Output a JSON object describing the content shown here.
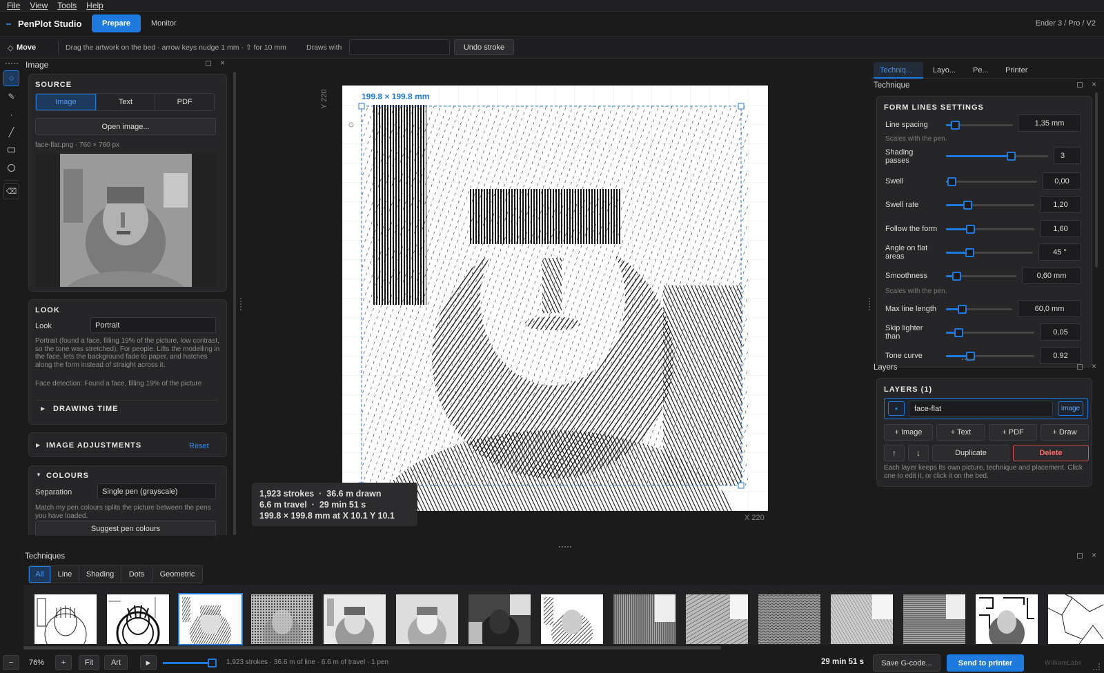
{
  "menu": [
    "File",
    "View",
    "Tools",
    "Help"
  ],
  "app": {
    "name": "PenPlot Studio",
    "tab_prepare": "Prepare",
    "tab_monitor": "Monitor",
    "printer_model": "Ender 3 / Pro / V2"
  },
  "toolbar": {
    "tool": "Move",
    "hint": "Drag the artwork on the bed · arrow keys nudge 1 mm · ⇧ for 10 mm",
    "draws_with": "Draws with",
    "draws_with_value": "",
    "undo": "Undo stroke"
  },
  "left": {
    "title": "Image",
    "source": {
      "heading": "SOURCE",
      "tabs": [
        "Image",
        "Text",
        "PDF"
      ],
      "open": "Open image...",
      "file": "face-flat.png · 760 × 760 px"
    },
    "look": {
      "heading": "LOOK",
      "label": "Look",
      "value": "Portrait",
      "desc": "Portrait (found a face, filling 19% of the picture, low contrast, so the tone was stretched). For people. Lifts the modelling in the face, lets the background fade to paper, and hatches along the form instead of straight across it.",
      "face": "Face detection: Found a face, filling 19% of the picture",
      "drawing_time": "DRAWING TIME"
    },
    "adjust": {
      "heading": "IMAGE ADJUSTMENTS",
      "reset": "Reset"
    },
    "colours": {
      "heading": "COLOURS",
      "label": "Separation",
      "value": "Single pen (grayscale)",
      "desc": "Match my pen colours splits the picture between the pens you have loaded.",
      "suggest": "Suggest pen colours"
    }
  },
  "canvas": {
    "ylabel": "Y 220",
    "xlabel": "X 220",
    "dims": "199.8 × 199.8 mm",
    "info": {
      "l1a": "1,923 strokes",
      "l1b": "36.6 m drawn",
      "l2a": "6.6 m travel",
      "l2b": "29 min 51 s",
      "l3": "199.8 × 199.8 mm at X 10.1  Y 10.1"
    }
  },
  "right": {
    "tabs": [
      "Techniq...",
      "Layo...",
      "Pe...",
      "Printer"
    ],
    "technique_title": "Technique",
    "settings_heading": "FORM LINES SETTINGS",
    "settings": [
      {
        "label": "Line spacing",
        "value": "1,35 mm",
        "hint": "Scales with the pen.",
        "pos": 0.08
      },
      {
        "label": "Shading passes",
        "value": "3",
        "pos": 0.65
      },
      {
        "label": "Swell",
        "value": "0,00",
        "pos": 0.02
      },
      {
        "label": "Swell rate",
        "value": "1,20",
        "pos": 0.22
      },
      {
        "label": "Follow the form",
        "value": "1,60",
        "pos": 0.25
      },
      {
        "label": "Angle on flat areas",
        "value": "45 °",
        "pos": 0.25
      },
      {
        "label": "Smoothness",
        "value": "0,60 mm",
        "hint": "Scales with the pen.",
        "pos": 0.1
      },
      {
        "label": "Max line length",
        "value": "60,0 mm",
        "pos": 0.2
      },
      {
        "label": "Skip lighter than",
        "value": "0,05",
        "pos": 0.1
      },
      {
        "label": "Tone curve",
        "value": "0.92",
        "pos": 0.25
      }
    ],
    "layers_title": "Layers",
    "layers_heading": "LAYERS  (1)",
    "layer": {
      "name": "face-flat",
      "type": "image"
    },
    "add": [
      "+ Image",
      "+ Text",
      "+ PDF",
      "+ Draw"
    ],
    "up": "↑",
    "down": "↓",
    "duplicate": "Duplicate",
    "delete": "Delete",
    "note": "Each layer keeps its own picture, technique and placement. Click one to edit it, or click it on the bed."
  },
  "techniques": {
    "title": "Techniques",
    "filters": [
      "All",
      "Line",
      "Shading",
      "Dots",
      "Geometric"
    ]
  },
  "status": {
    "minus": "−",
    "zoom": "76%",
    "plus": "+",
    "fit": "Fit",
    "art": "Art",
    "play": "▶",
    "summary": "1,923 strokes · 36.6 m of line · 6.6 m of travel · 1 pen",
    "time": "29 min 51 s",
    "save": "Save G-code...",
    "send": "Send to printer",
    "brand": "WilliamLabs",
    "playback": 1.0
  },
  "colors": {
    "accent": "#1f7ae0",
    "delete": "#e05050"
  }
}
